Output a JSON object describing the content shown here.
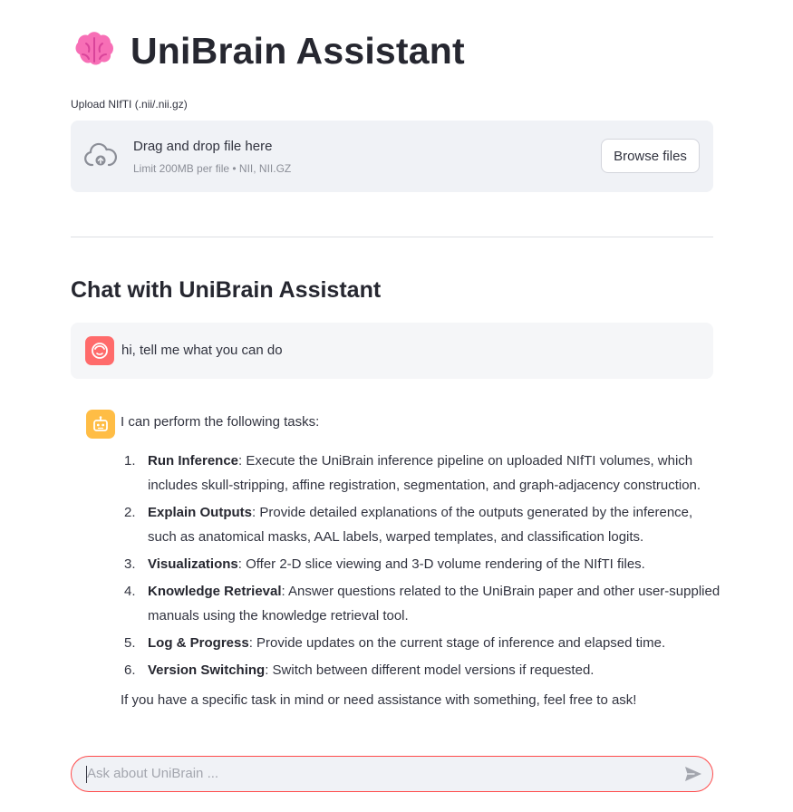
{
  "header": {
    "title": "UniBrain Assistant",
    "icon": "brain-icon"
  },
  "upload": {
    "label": "Upload NIfTI (.nii/.nii.gz)",
    "drop_text": "Drag and drop file here",
    "limit_text": "Limit 200MB per file • NII, NII.GZ",
    "browse_label": "Browse files"
  },
  "chat": {
    "heading": "Chat with UniBrain Assistant",
    "user_message": "hi, tell me what you can do",
    "assistant": {
      "intro": "I can perform the following tasks:",
      "tasks": [
        {
          "num": "1.",
          "title": "Run Inference",
          "text": ": Execute the UniBrain inference pipeline on uploaded NIfTI volumes, which includes skull-stripping, affine registration, segmentation, and graph-adjacency construction."
        },
        {
          "num": "2.",
          "title": "Explain Outputs",
          "text": ": Provide detailed explanations of the outputs generated by the inference, such as anatomical masks, AAL labels, warped templates, and classification logits."
        },
        {
          "num": "3.",
          "title": "Visualizations",
          "text": ": Offer 2-D slice viewing and 3-D volume rendering of the NIfTI files."
        },
        {
          "num": "4.",
          "title": "Knowledge Retrieval",
          "text": ": Answer questions related to the UniBrain paper and other user-supplied manuals using the knowledge retrieval tool."
        },
        {
          "num": "5.",
          "title": "Log & Progress",
          "text": ": Provide updates on the current stage of inference and elapsed time."
        },
        {
          "num": "6.",
          "title": "Version Switching",
          "text": ": Switch between different model versions if requested."
        }
      ],
      "outro": "If you have a specific task in mind or need assistance with something, feel free to ask!"
    },
    "input": {
      "placeholder": "Ask about UniBrain ..."
    }
  },
  "colors": {
    "accent": "#ff4b4b",
    "user_avatar": "#ff6b6b",
    "assistant_avatar": "#ffbd45",
    "panel_bg": "#f0f2f6"
  }
}
